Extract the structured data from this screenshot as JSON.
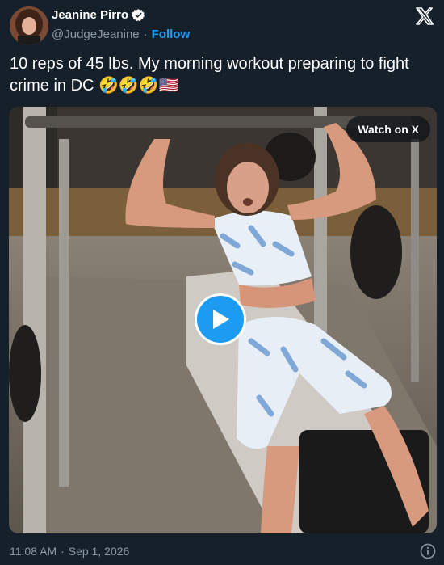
{
  "author": {
    "display_name": "Jeanine Pirro",
    "handle": "@JudgeJeanine",
    "separator": "·",
    "follow_label": "Follow"
  },
  "tweet": {
    "text": "10 reps of 45 lbs. My morning workout preparing to fight crime in DC 🤣🤣🤣🇺🇸"
  },
  "media": {
    "watch_label": "Watch on X"
  },
  "footer": {
    "time": "11:08 AM",
    "separator": "·",
    "date": "Sep 1, 2026"
  },
  "colors": {
    "background": "#15202b",
    "accent": "#1d9bf0",
    "secondary_text": "#8b98a5"
  },
  "icons": [
    "verified-badge-icon",
    "x-logo-icon",
    "play-icon",
    "info-icon"
  ]
}
